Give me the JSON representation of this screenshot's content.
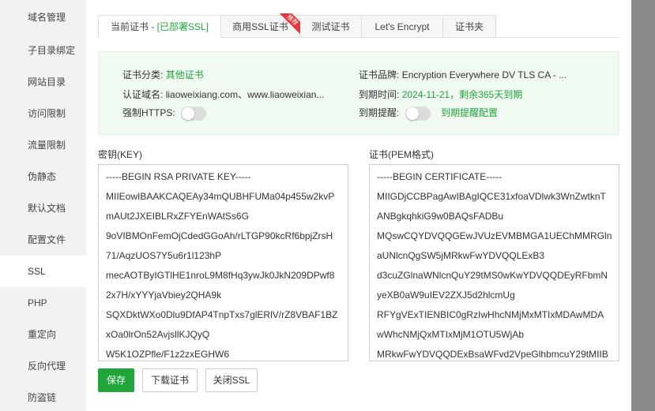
{
  "sidebar": {
    "items": [
      {
        "label": "域名管理"
      },
      {
        "label": "子目录绑定"
      },
      {
        "label": "网站目录"
      },
      {
        "label": "访问限制"
      },
      {
        "label": "流量限制"
      },
      {
        "label": "伪静态"
      },
      {
        "label": "默认文档"
      },
      {
        "label": "配置文件"
      },
      {
        "label": "SSL",
        "active": true
      },
      {
        "label": "PHP"
      },
      {
        "label": "重定向"
      },
      {
        "label": "反向代理"
      },
      {
        "label": "防盗链"
      }
    ]
  },
  "tabs": {
    "current_prefix": "当前证书 - ",
    "current_status": "[已部署SSL]",
    "commercial": "商用SSL证书",
    "commercial_badge": "推荐",
    "test": "测试证书",
    "letsencrypt": "Let's Encrypt",
    "folder": "证书夹"
  },
  "info": {
    "category_label": "证书分类:",
    "category_value": "其他证书",
    "brand_label": "证书品牌:",
    "brand_value": "Encryption Everywhere DV TLS CA - ...",
    "domain_label": "认证域名:",
    "domain_value": "liaoweixiang.com、www.liaoweixian...",
    "expire_label": "到期时间:",
    "expire_value": "2024-11-21，剩余365天到期",
    "https_label": "强制HTTPS:",
    "https_on": false,
    "remind_label": "到期提醒:",
    "remind_on": false,
    "remind_link": "到期提醒配置"
  },
  "key": {
    "label": "密钥(KEY)",
    "lines": [
      "-----BEGIN RSA PRIVATE KEY-----",
      "MIIEowIBAAKCAQEAy34mQUBHFUMa04p455w2kvP",
      "mAUt2JXEIBLRxZFYEnWAtSs6G",
      "9oVIBMOnFemOjCdedGGoAh/rLTGP90kcRf6bpjZrsH",
      "71/AqzUOS7Y5u6r1l123hP",
      "mecAOTByIGTlHE1nroL9M8fHq3ywJk0JkN209DPwf8",
      "2x7H/xYYYjaVbiey2QHA9k",
      "SQXDktWXo0Dlu9DfAP4TnpTxs7glERlV/rZ8VBAF1BZ",
      "xOa0lrOn52AvjsllKJQyQ",
      "W5K1OZPfle/F1z2zxEGHW6"
    ]
  },
  "cert": {
    "label": "证书(PEM格式)",
    "lines": [
      "-----BEGIN CERTIFICATE-----",
      "MIIGDjCCBPagAwIBAgIQCE31xfoaVDlwk3WnZwtknT",
      "ANBgkqhkiG9w0BAQsFADBu",
      "MQswCQYDVQQGEwJVUzEVMBMGA1UEChMMRGln",
      "aUNlcnQgSW5jMRkwFwYDVQQLExB3",
      "d3cuZGlnaWNlcnQuY29tMS0wKwYDVQQDEyRFbmN",
      "yeXB0aW9uIEV2ZXJ5d2hlcmUg",
      "RFYgVExTIENBIC0gRzIwHhcNMjMxMTIxMDAwMDA",
      "wWhcNMjQxMTIxMjM1OTU5WjAb",
      "MRkwFwYDVQQDExBsaWFvd2VpeGlhbmcuY29tMIIB"
    ]
  },
  "buttons": {
    "save": "保存",
    "download": "下载证书",
    "close_ssl": "关闭SSL"
  },
  "colors": {
    "accent": "#20a53a",
    "badge": "#e4393c"
  }
}
